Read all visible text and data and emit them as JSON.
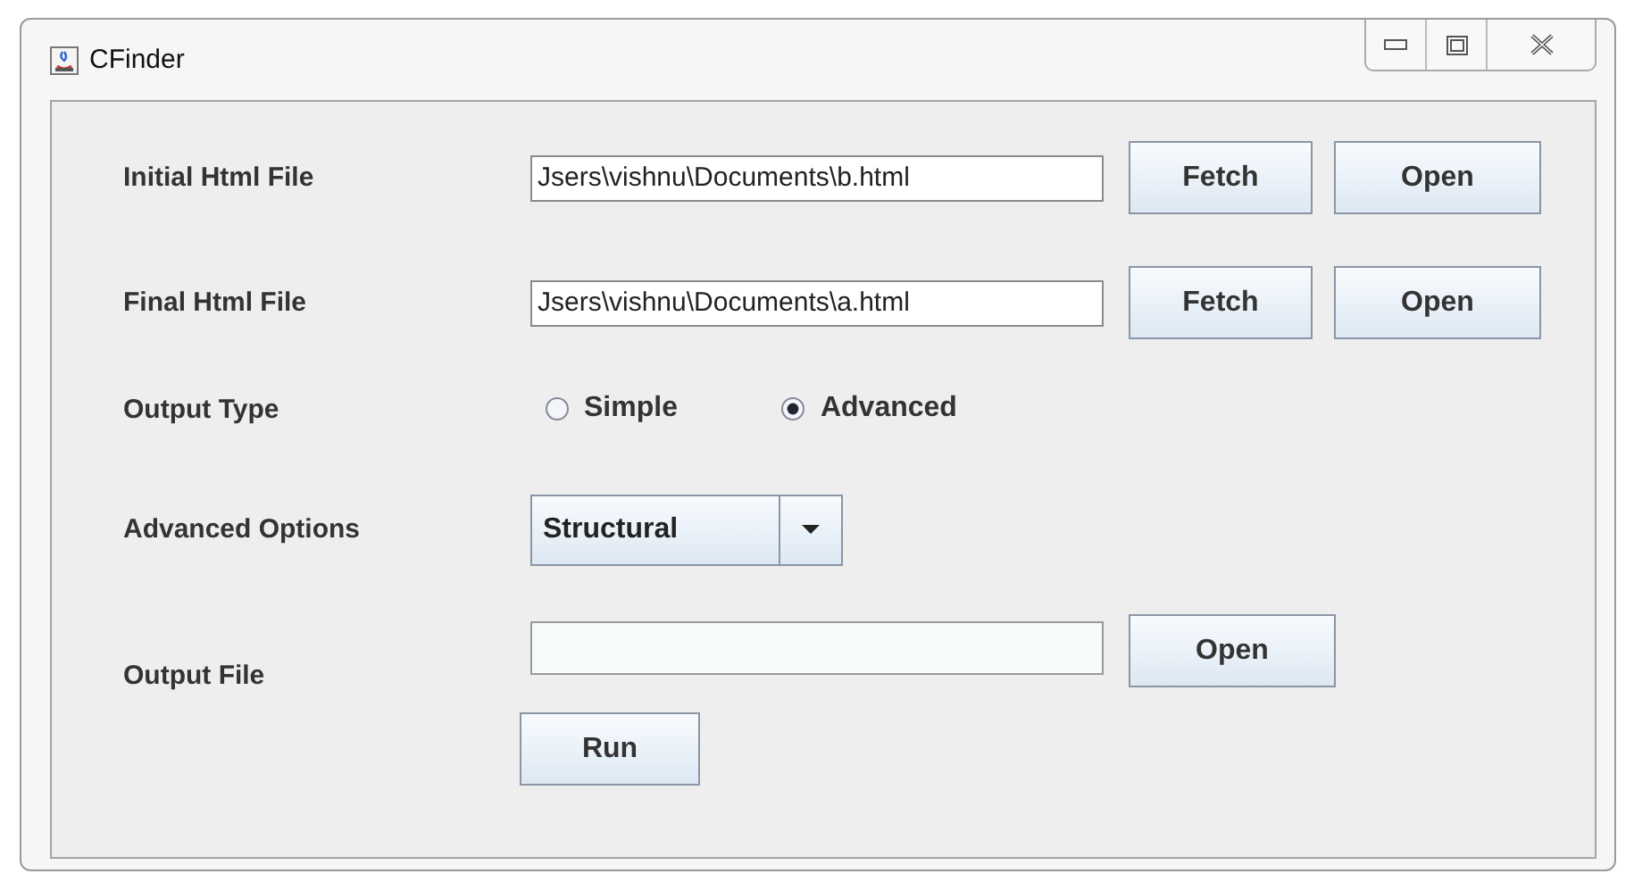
{
  "window": {
    "title": "CFinder"
  },
  "rows": [
    {
      "kind": "file",
      "label": "Initial Html File",
      "value": "Jsers\\vishnu\\Documents\\b.html",
      "buttons": [
        "Fetch",
        "Open"
      ]
    },
    {
      "kind": "file",
      "label": "Final Html File",
      "value": "Jsers\\vishnu\\Documents\\a.html",
      "buttons": [
        "Fetch",
        "Open"
      ]
    },
    {
      "kind": "radio",
      "label": "Output Type",
      "options": [
        {
          "label": "Simple",
          "selected": false
        },
        {
          "label": "Advanced",
          "selected": true
        }
      ]
    },
    {
      "kind": "combo",
      "label": "Advanced Options",
      "value": "Structural"
    },
    {
      "kind": "output",
      "label": "Output File",
      "buttons": [
        "Open"
      ]
    }
  ],
  "run_button": "Run"
}
